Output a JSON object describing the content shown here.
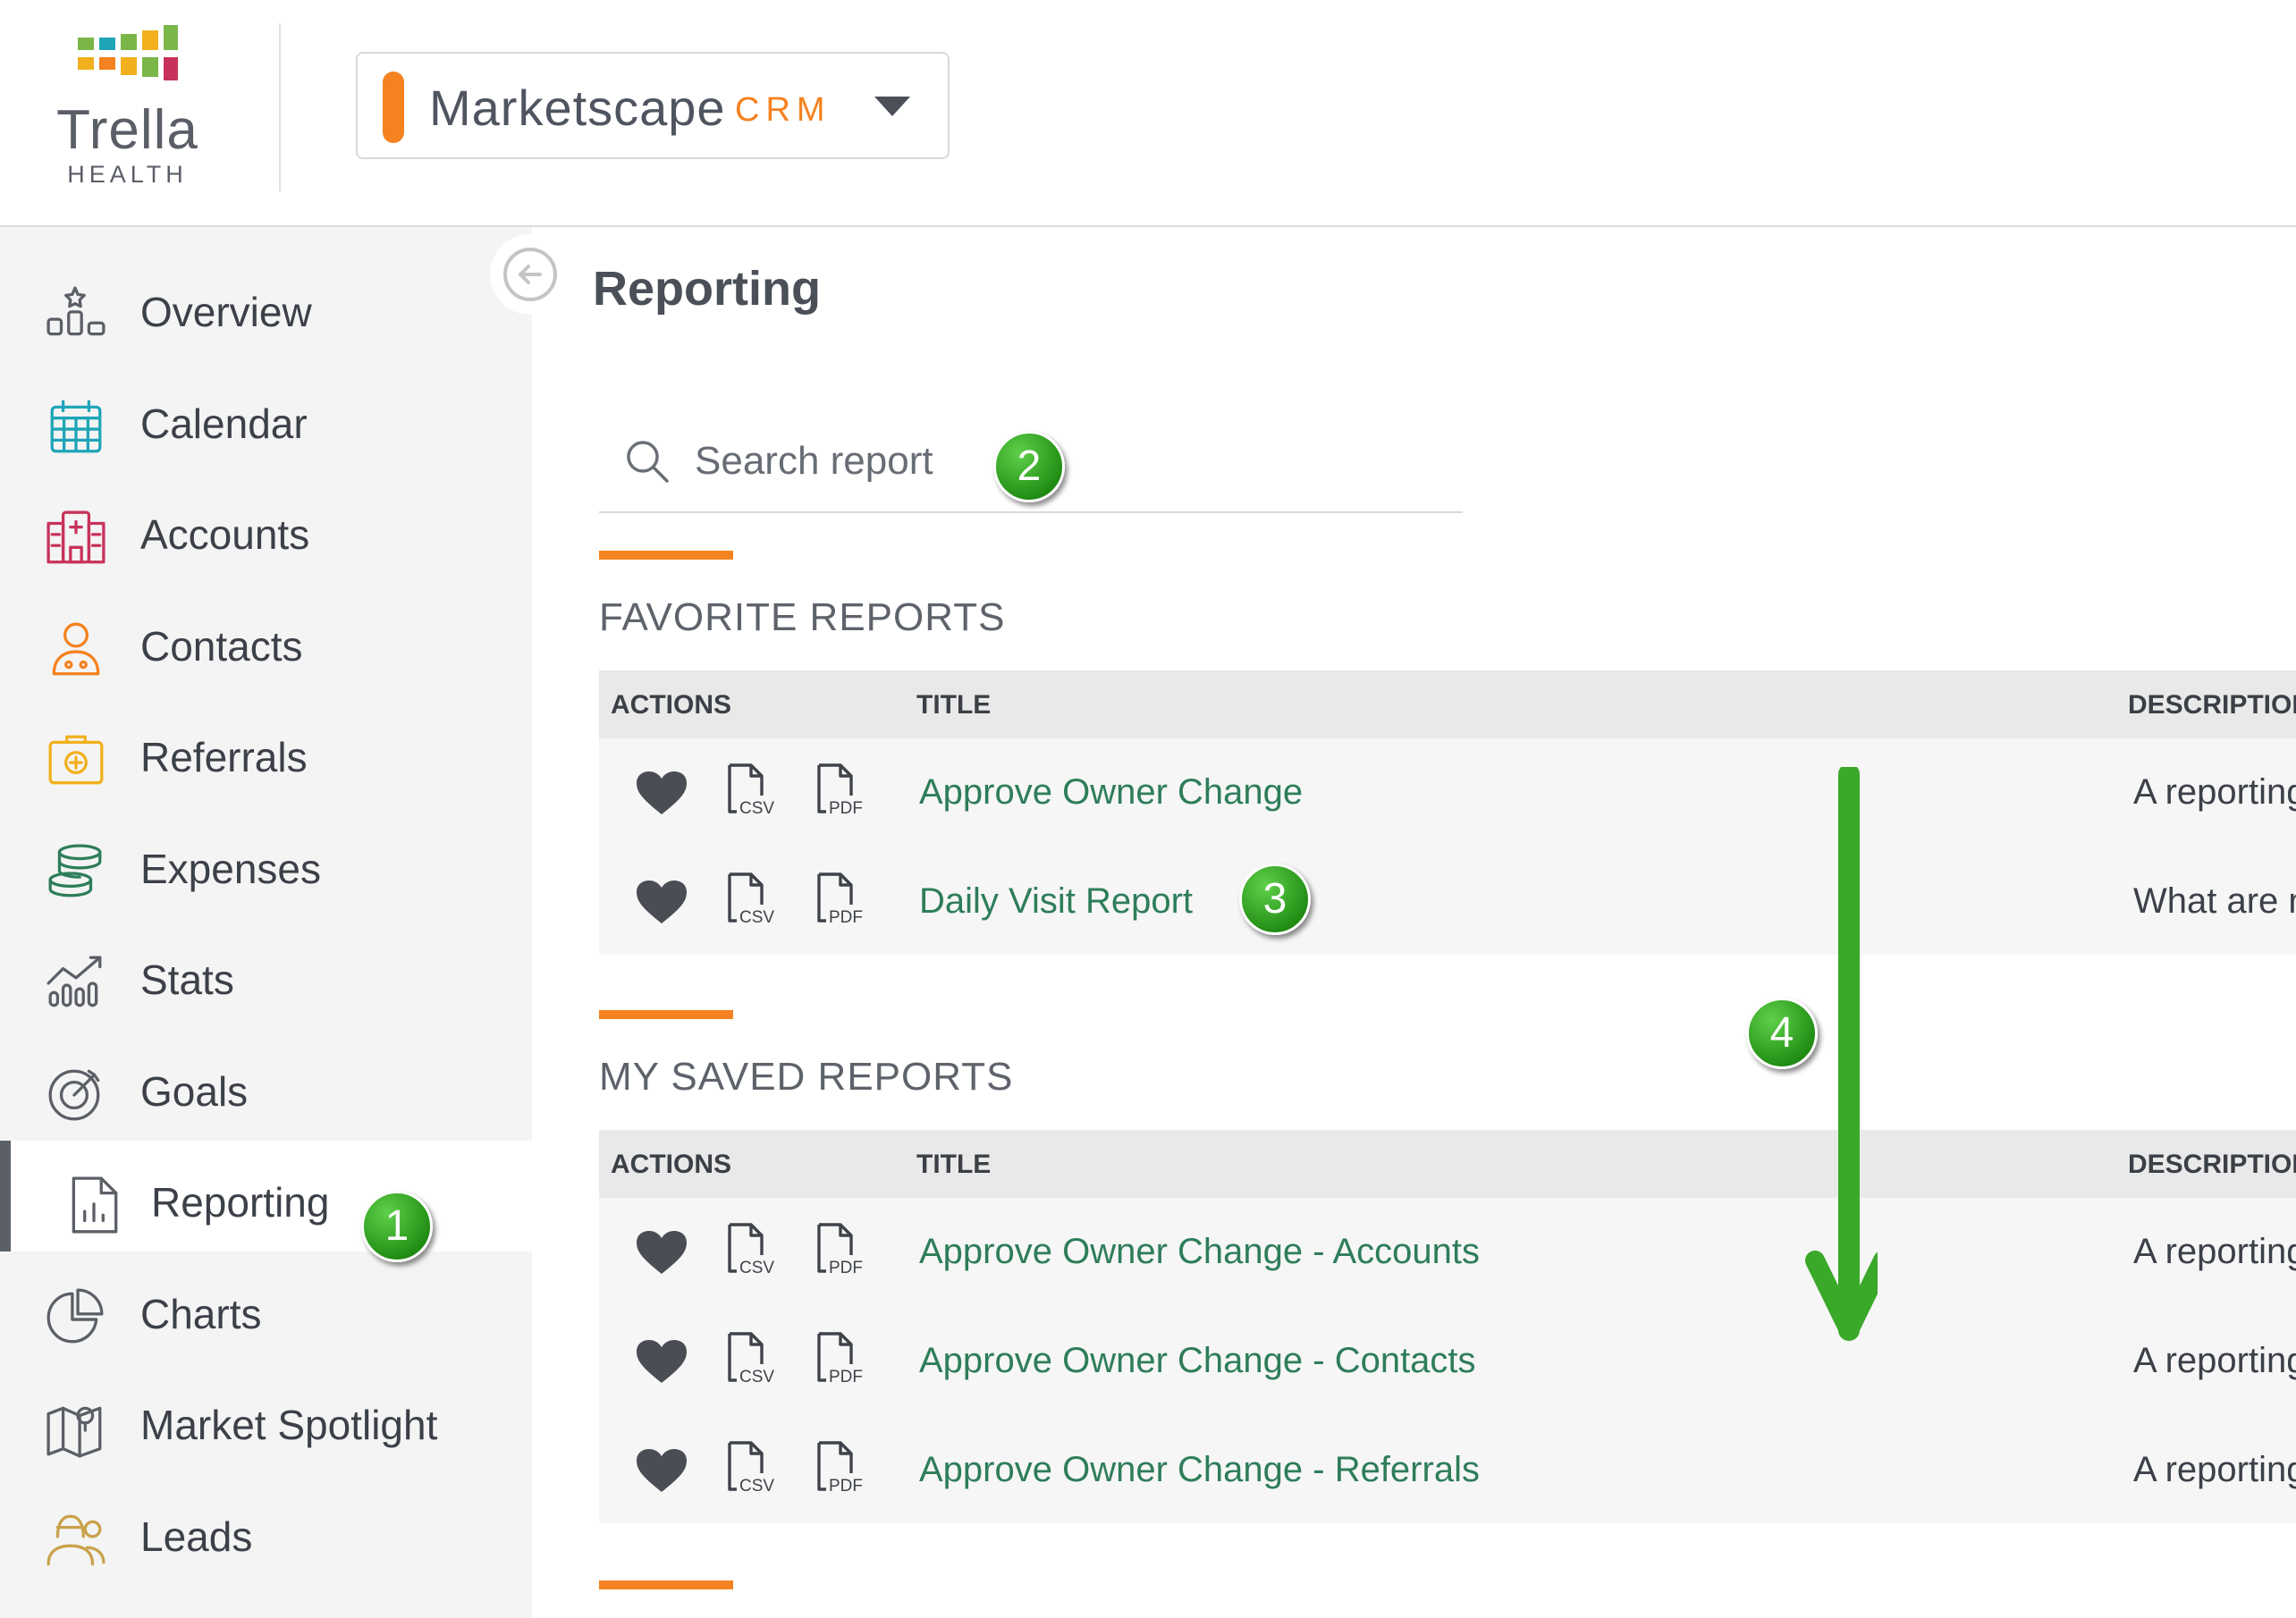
{
  "header": {
    "logo": {
      "name": "Trella",
      "sub": "HEALTH"
    },
    "app_selector": {
      "name": "Marketscape",
      "suffix": "CRM",
      "bar_color": "#f58220",
      "suffix_color": "#f58220"
    }
  },
  "sidebar": {
    "items": [
      {
        "label": "Overview",
        "icon": "overview-icon",
        "color": "#5b5f66"
      },
      {
        "label": "Calendar",
        "icon": "calendar-icon",
        "color": "#1fa5b8"
      },
      {
        "label": "Accounts",
        "icon": "accounts-icon",
        "color": "#c8325a"
      },
      {
        "label": "Contacts",
        "icon": "contacts-icon",
        "color": "#f58220"
      },
      {
        "label": "Referrals",
        "icon": "referrals-icon",
        "color": "#f2b01e"
      },
      {
        "label": "Expenses",
        "icon": "expenses-icon",
        "color": "#2e7d5a"
      },
      {
        "label": "Stats",
        "icon": "stats-icon",
        "color": "#5b5f66"
      },
      {
        "label": "Goals",
        "icon": "goals-icon",
        "color": "#5b5f66"
      },
      {
        "label": "Reporting",
        "icon": "reporting-icon",
        "color": "#5b5f66",
        "active": true
      },
      {
        "label": "Charts",
        "icon": "charts-icon",
        "color": "#5b5f66"
      },
      {
        "label": "Market Spotlight",
        "icon": "map-icon",
        "color": "#5b5f66"
      },
      {
        "label": "Leads",
        "icon": "leads-icon",
        "color": "#c9a24a"
      }
    ]
  },
  "main": {
    "title": "Reporting",
    "search": {
      "placeholder": "Search report"
    },
    "favorite": {
      "title": "FAVORITE REPORTS",
      "columns": {
        "actions": "ACTIONS",
        "title": "TITLE",
        "description": "DESCRIPTION"
      },
      "rows": [
        {
          "title": "Approve Owner Change",
          "description": "A reporting"
        },
        {
          "title": "Daily Visit Report",
          "description": "What are n"
        }
      ]
    },
    "saved": {
      "title": "MY SAVED REPORTS",
      "columns": {
        "actions": "ACTIONS",
        "title": "TITLE",
        "description": "DESCRIPTION"
      },
      "rows": [
        {
          "title": "Approve Owner Change - Accounts",
          "description": "A reporting"
        },
        {
          "title": "Approve Owner Change - Contacts",
          "description": "A reporting"
        },
        {
          "title": "Approve Owner Change - Referrals",
          "description": "A reporting"
        }
      ]
    }
  },
  "annotations": {
    "badges": [
      "1",
      "2",
      "3",
      "4"
    ],
    "badge_color": "#2e9a1e",
    "arrow_color": "#3aa829"
  },
  "file_labels": {
    "csv": "CSV",
    "pdf": "PDF"
  }
}
